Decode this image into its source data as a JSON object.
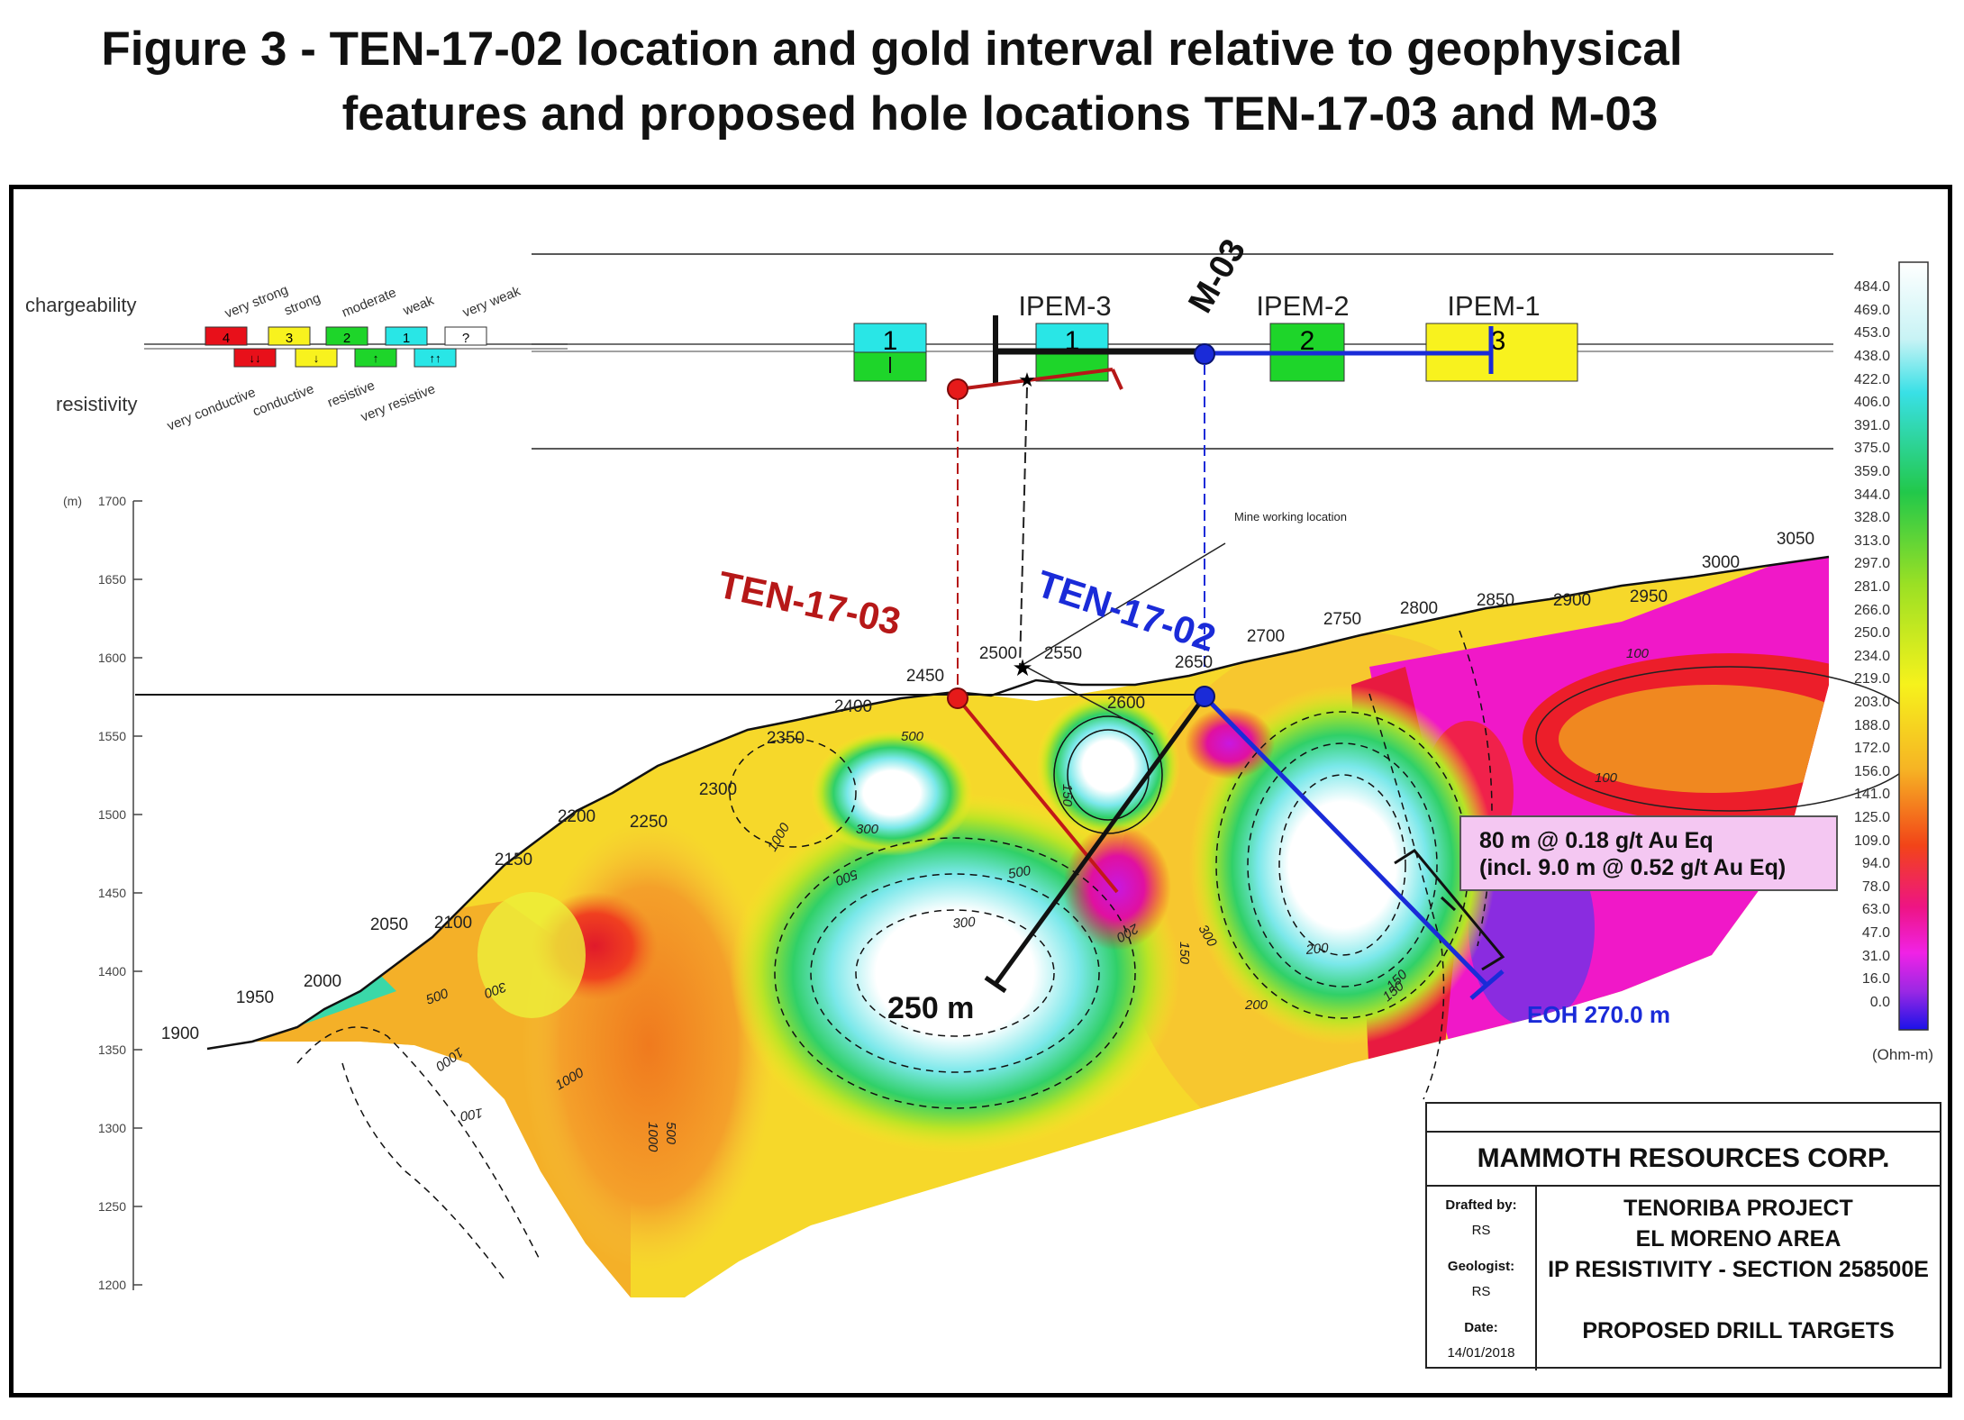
{
  "title_line1": "Figure 3 - TEN-17-02 location and gold interval relative to geophysical",
  "title_line2": "features and proposed hole locations TEN-17-03 and M-03",
  "legend": {
    "chargeability_label": "chargeability",
    "resistivity_label": "resistivity",
    "chargeability_classes": [
      {
        "label": "very strong",
        "value": "4",
        "color": "#e8101a"
      },
      {
        "label": "strong",
        "value": "3",
        "color": "#f8f21e"
      },
      {
        "label": "moderate",
        "value": "2",
        "color": "#1ed52a"
      },
      {
        "label": "weak",
        "value": "1",
        "color": "#29e6e6"
      },
      {
        "label": "very weak",
        "value": "?",
        "color": "#ffffff"
      }
    ],
    "resistivity_classes": [
      "very conductive",
      "conductive",
      "resistive",
      "very resistive"
    ]
  },
  "ipem": {
    "labels": [
      "IPEM-3",
      "IPEM-2",
      "IPEM-1"
    ],
    "box_values": [
      "1",
      "1",
      "2",
      "3"
    ]
  },
  "holes": {
    "m03": {
      "label": "M-03",
      "color": "#000000"
    },
    "ten1703": {
      "label": "TEN-17-03",
      "color": "#b61818"
    },
    "ten1702": {
      "label": "TEN-17-02",
      "color": "#1a2bd8"
    }
  },
  "mine_working_label": "Mine working location",
  "elevation_axis": {
    "unit": "(m)",
    "ticks": [
      "1700",
      "1650",
      "1600",
      "1550",
      "1500",
      "1450",
      "1400",
      "1350",
      "1300",
      "1250",
      "1200"
    ]
  },
  "stations": [
    "1900",
    "1950",
    "2000",
    "2050",
    "2100",
    "2150",
    "2200",
    "2250",
    "2300",
    "2350",
    "2400",
    "2450",
    "2500",
    "2550",
    "2600",
    "2650",
    "2700",
    "2750",
    "2800",
    "2850",
    "2900",
    "2950",
    "3000",
    "3050"
  ],
  "contour_labels": [
    "500",
    "1000",
    "500",
    "300",
    "200",
    "150",
    "100",
    "1000",
    "500",
    "300",
    "200",
    "150",
    "100",
    "1000",
    "500",
    "300",
    "200",
    "150",
    "100",
    "500",
    "1000",
    "150",
    "300",
    "500"
  ],
  "annotations": {
    "depth_250": "250 m",
    "eoh": "EOH 270.0 m",
    "interval_line1": "80 m @ 0.18 g/t Au Eq",
    "interval_line2": "(incl. 9.0 m @ 0.52 g/t Au Eq)"
  },
  "colorbar": {
    "unit": "(Ohm-m)",
    "values": [
      "484.0",
      "469.0",
      "453.0",
      "438.0",
      "422.0",
      "406.0",
      "391.0",
      "375.0",
      "359.0",
      "344.0",
      "328.0",
      "313.0",
      "297.0",
      "281.0",
      "266.0",
      "250.0",
      "234.0",
      "219.0",
      "203.0",
      "188.0",
      "172.0",
      "156.0",
      "141.0",
      "125.0",
      "109.0",
      "94.0",
      "78.0",
      "63.0",
      "47.0",
      "31.0",
      "16.0",
      "0.0"
    ]
  },
  "title_block": {
    "company": "MAMMOTH RESOURCES CORP.",
    "drafted_by_label": "Drafted by:",
    "drafted_by": "RS",
    "geologist_label": "Geologist:",
    "geologist": "RS",
    "date_label": "Date:",
    "date": "14/01/2018",
    "project": "TENORIBA PROJECT",
    "area": "EL MORENO AREA",
    "section": "IP RESISTIVITY - SECTION 258500E",
    "subject": "PROPOSED DRILL TARGETS"
  }
}
